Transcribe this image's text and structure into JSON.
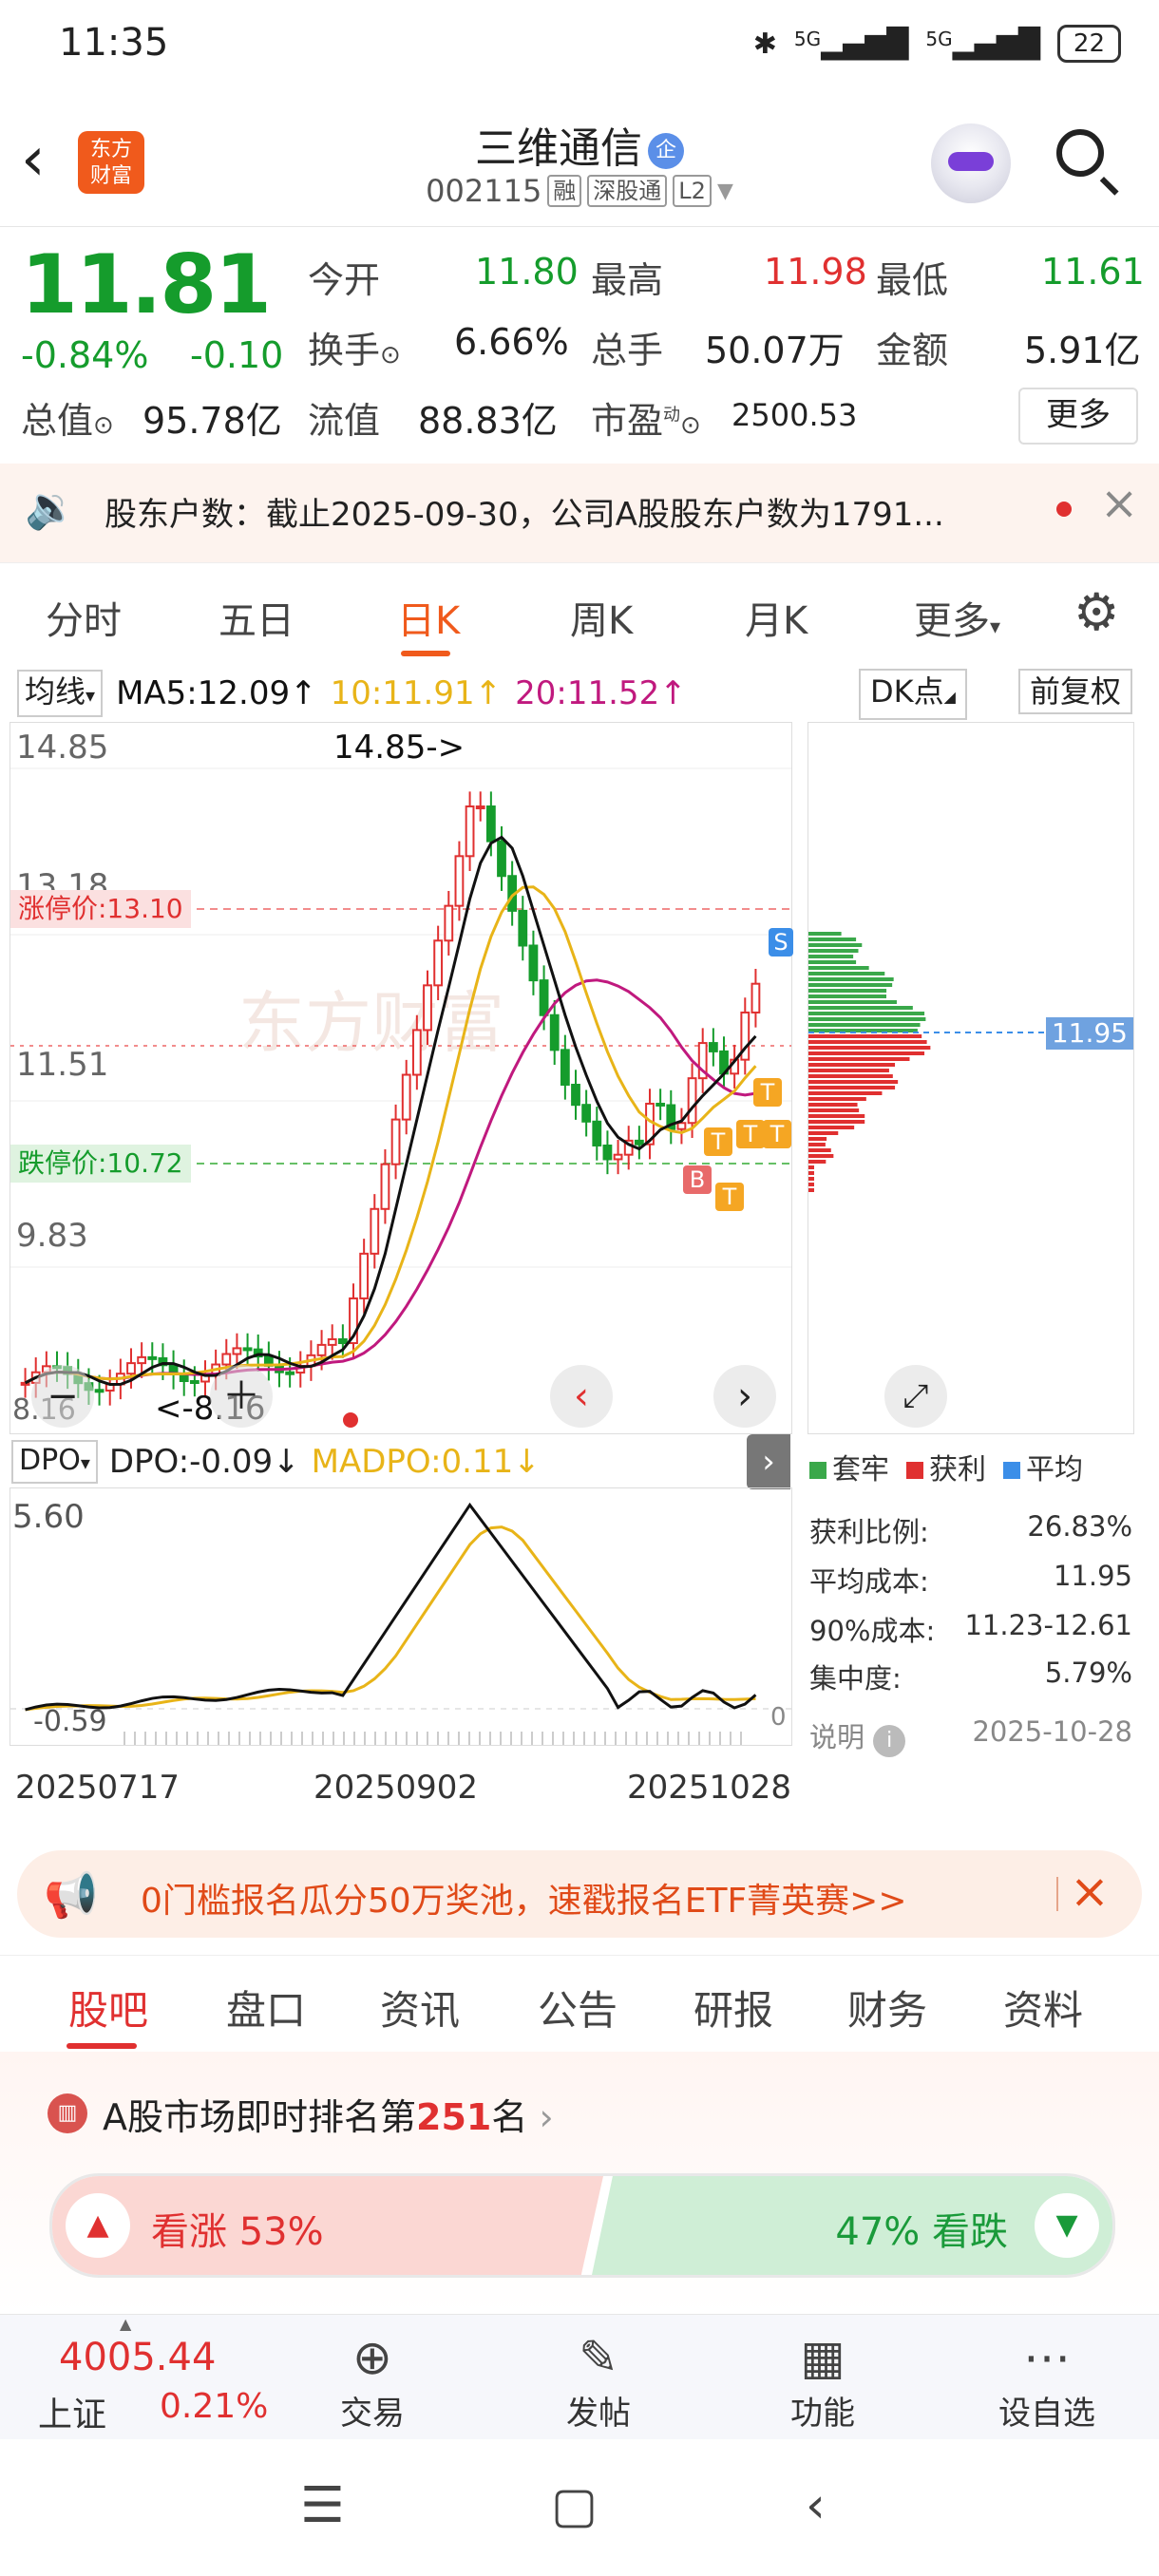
{
  "status": {
    "time": "11:35",
    "signal1": "5G",
    "signal2": "5G",
    "battery": "22"
  },
  "header": {
    "logo_line1": "东方",
    "logo_line2": "财富",
    "name": "三维通信",
    "name_badge": "企",
    "code": "002115",
    "tags": [
      "融",
      "深股通",
      "L2"
    ]
  },
  "quote": {
    "price": "11.81",
    "change_pct": "-0.84%",
    "change_amt": "-0.10",
    "open_label": "今开",
    "open": "11.80",
    "high_label": "最高",
    "high": "11.98",
    "low_label": "最低",
    "low": "11.61",
    "turnover_label": "换手",
    "turnover": "6.66%",
    "volume_label": "总手",
    "volume": "50.07万",
    "amount_label": "金额",
    "amount": "5.91亿",
    "mktcap_label": "总值",
    "mktcap": "95.78亿",
    "float_label": "流值",
    "float": "88.83亿",
    "pe_label": "市盈",
    "pe_sup": "动",
    "pe": "2500.53",
    "more": "更多"
  },
  "news": {
    "text": "股东户数：截止2025-09-30，公司A股股东户数为1791..."
  },
  "ktabs": [
    "分时",
    "五日",
    "日K",
    "周K",
    "月K",
    "更多"
  ],
  "chart_head": {
    "ma_select": "均线",
    "ma5": "MA5:12.09",
    "ma10": "10:11.91",
    "ma20": "20:11.52",
    "dk": "DK点",
    "adjust": "前复权"
  },
  "kchart": {
    "y_top": "14.85",
    "y_2": "13.18",
    "y_mid": "11.51",
    "y_4": "9.83",
    "y_bottom": "8.16",
    "high_marker": "14.85->",
    "low_marker": "<-8.16",
    "limit_up": "涨停价:13.10",
    "limit_down": "跌停价:10.72",
    "avg_cost_tag": "11.95",
    "signal_s": "S",
    "signal_b": "B",
    "signal_t": "T"
  },
  "dpo": {
    "select": "DPO",
    "dpo": "DPO:-0.09",
    "madpo": "MADPO:0.11",
    "y_top": "5.60",
    "y_bottom": "-0.59",
    "y_zero": "0"
  },
  "dates": [
    "20250717",
    "20250902",
    "20251028"
  ],
  "chips": {
    "legend": [
      "套牢",
      "获利",
      "平均"
    ],
    "stats": [
      {
        "label": "获利比例:",
        "value": "26.83%"
      },
      {
        "label": "平均成本:",
        "value": "11.95"
      },
      {
        "label": "90%成本:",
        "value": "11.23-12.61"
      },
      {
        "label": "集中度:",
        "value": "5.79%"
      }
    ],
    "note_label": "说明",
    "date": "2025-10-28"
  },
  "banner": {
    "text": "0门槛报名瓜分50万奖池，速戳报名ETF菁英赛>>"
  },
  "btabs": [
    "股吧",
    "盘口",
    "资讯",
    "公告",
    "研报",
    "财务",
    "资料"
  ],
  "ranking": {
    "prefix": "A股市场即时排名第",
    "num": "251",
    "suffix": "名"
  },
  "vote": {
    "up": "看涨 53%",
    "down": "47% 看跌",
    "up_value": 53,
    "down_value": 47
  },
  "bottom_nav": {
    "index_value": "4005.44",
    "index_name": "上证",
    "index_change": "0.21%",
    "items": [
      {
        "label": "交易",
        "icon": "yen-icon"
      },
      {
        "label": "发帖",
        "icon": "edit-icon"
      },
      {
        "label": "功能",
        "icon": "grid-icon"
      },
      {
        "label": "设自选",
        "icon": "more-circle-icon"
      }
    ]
  },
  "colors": {
    "up": "#e03030",
    "down": "#159c2c",
    "brand": "#f05a1c",
    "ma5": "#111111",
    "ma10": "#e8b418",
    "ma20": "#c0197e"
  }
}
